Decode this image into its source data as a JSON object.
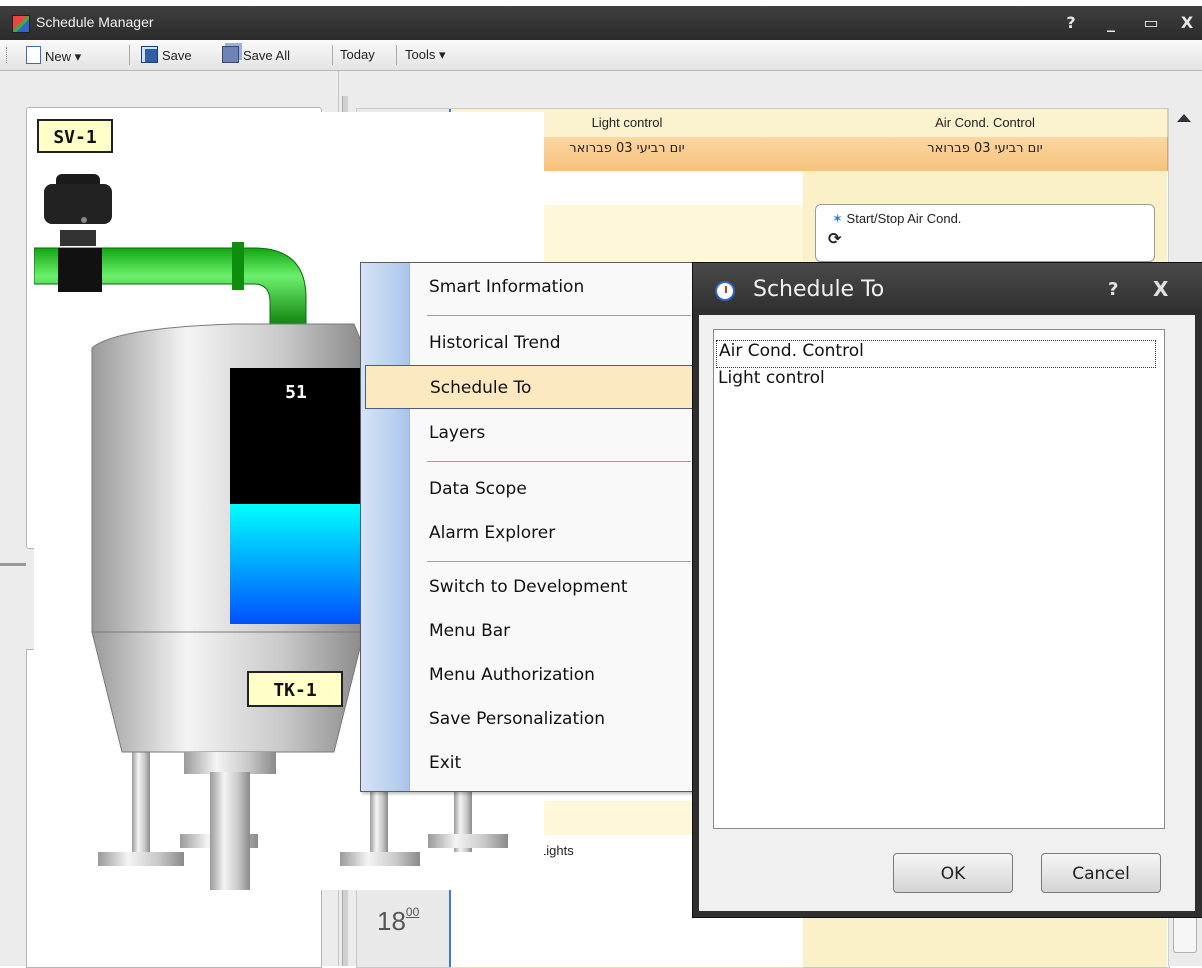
{
  "window": {
    "title": "Schedule Manager",
    "help_glyph": "?",
    "minimize_glyph": "_",
    "maximize_glyph": "▭",
    "close_glyph": "X"
  },
  "toolbar": {
    "new_label": "New",
    "save_label": "Save",
    "save_all_label": "Save All",
    "today_label": "Today",
    "tools_label": "Tools",
    "dropdown_glyph": "▾"
  },
  "calendar": {
    "columns": [
      {
        "header": "Light control",
        "date": "יום רביעי 03 פברואר"
      },
      {
        "header": "Air Cond. Control",
        "date": "יום רביעי 03 פברואר"
      }
    ],
    "appointments": [
      {
        "title": "Start/Stop Air Cond.",
        "recurrence_glyph": "⟳"
      },
      {
        "title": "Lights"
      }
    ],
    "time_label_hour": "18",
    "time_label_minutes": "00"
  },
  "tank": {
    "valve_tag": "SV-1",
    "tank_tag": "TK-1",
    "level_value": "51",
    "level_fraction": 0.47,
    "colors": {
      "pipe": "#1ec51e",
      "liquid_top": "#00ffff",
      "liquid_bottom": "#0050ff"
    }
  },
  "context_menu": {
    "items": [
      "Smart Information",
      "Historical Trend",
      "Schedule To",
      "Layers",
      "Data Scope",
      "Alarm Explorer",
      "Switch to Development",
      "Menu Bar",
      "Menu Authorization",
      "Save Personalization",
      "Exit"
    ],
    "highlighted": "Schedule To"
  },
  "dialog": {
    "title": "Schedule To",
    "help_glyph": "?",
    "close_glyph": "X",
    "list_items": [
      "Air Cond. Control",
      "Light control"
    ],
    "selected_item": "Air Cond. Control",
    "ok_label": "OK",
    "cancel_label": "Cancel"
  }
}
